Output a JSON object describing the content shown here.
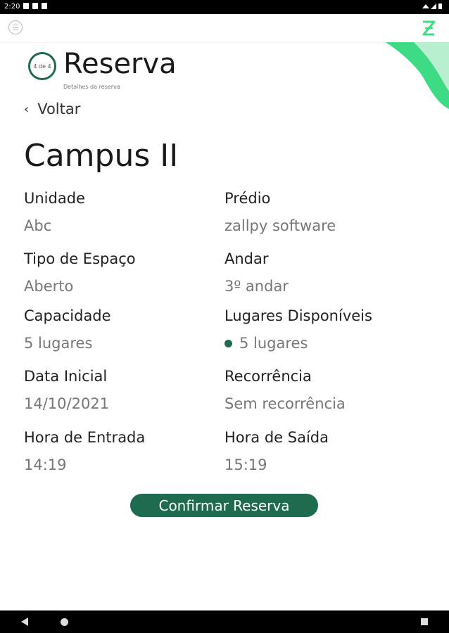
{
  "status_bar": {
    "time": "2:20"
  },
  "header": {
    "step": "4 de 4",
    "title": "Reserva",
    "subtitle": "Detalhes da reserva"
  },
  "back_label": "Voltar",
  "place_name": "Campus II",
  "fields": [
    {
      "label": "Unidade",
      "value": "Abc"
    },
    {
      "label": "Prédio",
      "value": "zallpy software"
    },
    {
      "label": "Tipo de Espaço",
      "value": "Aberto"
    },
    {
      "label": "Andar",
      "value": "3º andar"
    },
    {
      "label": "Capacidade",
      "value": "5 lugares"
    },
    {
      "label": "Lugares Disponíveis",
      "value": "5 lugares"
    },
    {
      "label": "Data Inicial",
      "value": "14/10/2021"
    },
    {
      "label": "Recorrência",
      "value": "Sem recorrência"
    },
    {
      "label": "Hora de Entrada",
      "value": "14:19"
    },
    {
      "label": "Hora de Saída",
      "value": "15:19"
    }
  ],
  "confirm_button": "Confirmar Reserva",
  "colors": {
    "primary": "#1e6b4f",
    "accent": "#3ddc84"
  },
  "icons": [
    "menu-icon",
    "zallpy-logo-icon",
    "chevron-left-icon",
    "availability-dot-icon"
  ]
}
